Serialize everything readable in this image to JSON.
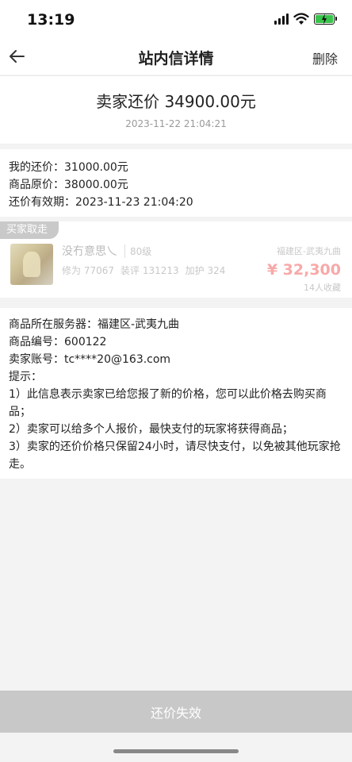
{
  "status_bar": {
    "time": "13:19"
  },
  "nav": {
    "title": "站内信详情",
    "delete_label": "删除"
  },
  "header": {
    "title": "卖家还价  34900.00元",
    "timestamp": "2023-11-22 21:04:21"
  },
  "prices": {
    "my_offer": "我的还价：31000.00元",
    "original_price": "商品原价：38000.00元",
    "valid_until": "还价有效期：2023-11-23 21:04:20"
  },
  "product": {
    "badge": "买家取走",
    "name": "没冇意思乀",
    "level": "80级",
    "stats": [
      "修为 77067",
      "装评 131213",
      "加护 324"
    ],
    "server": "福建区-武夷九曲",
    "price": "¥ 32,300",
    "favorites": "14人收藏"
  },
  "info": {
    "server_line": "商品所在服务器：福建区-武夷九曲",
    "item_no": "商品编号：600122",
    "seller_account": "卖家账号：tc****20@163.com",
    "tips_label": "提示：",
    "tip1": "1）此信息表示卖家已给您报了新的价格，您可以此价格去购买商品；",
    "tip2": "2）卖家可以给多个人报价，最快支付的玩家将获得商品；",
    "tip3": "3）卖家的还价价格只保留24小时，请尽快支付，以免被其他玩家抢走。"
  },
  "footer": {
    "button_label": "还价失效"
  },
  "colors": {
    "price_red": "#f7a9a9",
    "disabled_button": "#c8c8c8",
    "battery_green": "#3ac34a"
  }
}
